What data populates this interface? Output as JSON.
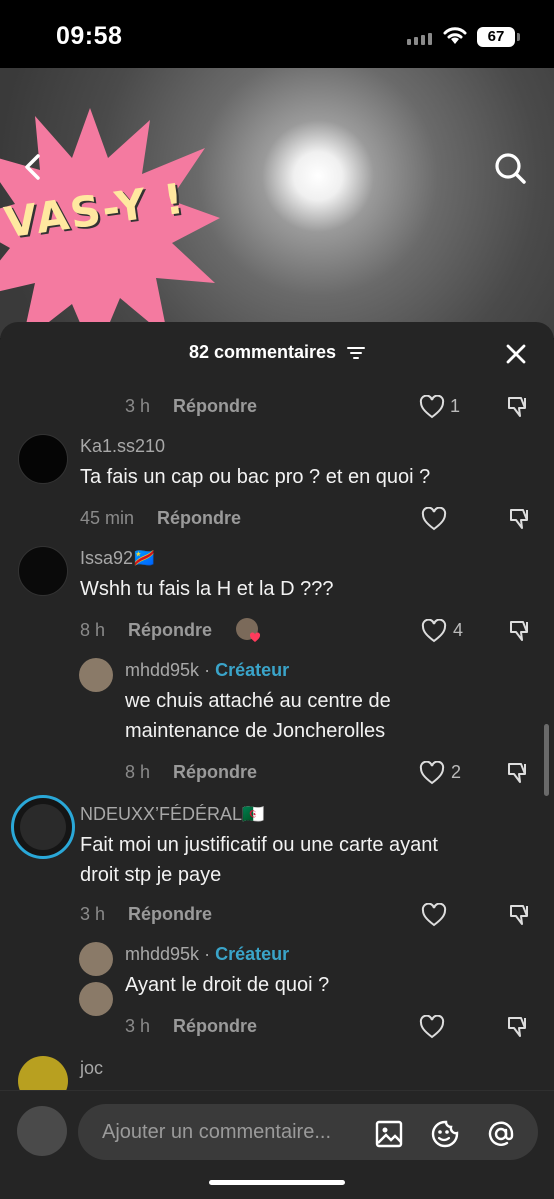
{
  "status": {
    "time": "09:58",
    "battery": "67"
  },
  "video": {
    "overlay_text": "VAS-Y !"
  },
  "comments_header": {
    "count_label": "82 commentaires"
  },
  "comments": [
    {
      "meta": "3 h",
      "reply": "Répondre",
      "likes": "1"
    },
    {
      "user": "Ka1.ss210",
      "text": "Ta fais un cap ou bac pro ? et en quoi ?",
      "meta": "45 min",
      "reply": "Répondre",
      "likes": ""
    },
    {
      "user": "Issa92🇨🇩",
      "text": "Wshh tu fais la H et la D ???",
      "meta": "8 h",
      "reply": "Répondre",
      "likes": "4"
    },
    {
      "user": "mhdd95k",
      "badge": "Créateur",
      "text_lines": [
        "we chuis attaché au centre de",
        "maintenance de Joncherolles"
      ],
      "meta": "8 h",
      "reply": "Répondre",
      "likes": "2"
    },
    {
      "user": "NDEUXX’FÉDÉRAL🇩🇿",
      "text_lines": [
        "Fait moi un justificatif ou une carte ayant",
        "droit stp je paye"
      ],
      "meta": "3 h",
      "reply": "Répondre",
      "likes": ""
    },
    {
      "user": "mhdd95k",
      "badge": "Créateur",
      "text": "Ayant le droit de quoi ?",
      "meta": "3 h",
      "reply": "Répondre",
      "likes": ""
    },
    {
      "user": "joc"
    }
  ],
  "composer": {
    "placeholder": "Ajouter un commentaire..."
  },
  "colors": {
    "panel": "#252525",
    "creator": "#3aa4c9",
    "heart_badge": "#ff3b5c"
  }
}
